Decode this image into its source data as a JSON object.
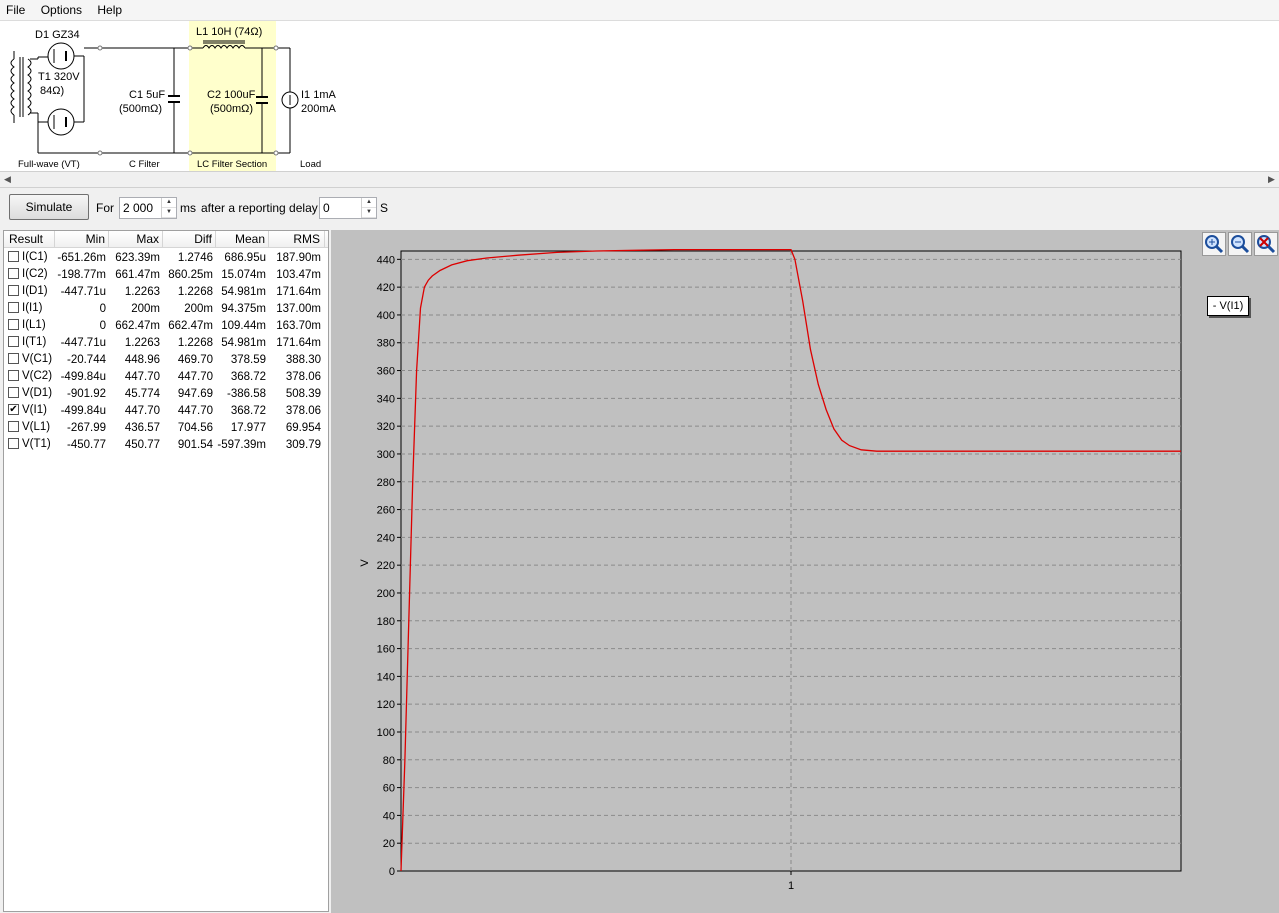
{
  "menu": [
    "File",
    "Options",
    "Help"
  ],
  "schematic": {
    "d1": "D1 GZ34",
    "t1": "T1 320V",
    "t1r": "84Ω)",
    "c1a": "C1 5uF",
    "c1b": "(500mΩ)",
    "l1": "L1 10H (74Ω)",
    "c2a": "C2 100uF",
    "c2b": "(500mΩ)",
    "i1a": "I1 1mA",
    "i1b": "200mA",
    "sec1": "Full-wave (VT)",
    "sec2": "C Filter",
    "sec3": "LC Filter Section",
    "sec4": "Load"
  },
  "toolbar": {
    "simulate": "Simulate",
    "for": "For",
    "duration": "2 000",
    "ms": "ms",
    "delay_label": "after a reporting delay of",
    "delay": "0",
    "s": "S"
  },
  "results": {
    "headers": [
      "Result",
      "Min",
      "Max",
      "Diff",
      "Mean",
      "RMS"
    ],
    "rows": [
      {
        "name": "I(C1)",
        "checked": false,
        "min": "-651.26m",
        "max": "623.39m",
        "diff": "1.2746",
        "mean": "686.95u",
        "rms": "187.90m"
      },
      {
        "name": "I(C2)",
        "checked": false,
        "min": "-198.77m",
        "max": "661.47m",
        "diff": "860.25m",
        "mean": "15.074m",
        "rms": "103.47m"
      },
      {
        "name": "I(D1)",
        "checked": false,
        "min": "-447.71u",
        "max": "1.2263",
        "diff": "1.2268",
        "mean": "54.981m",
        "rms": "171.64m"
      },
      {
        "name": "I(I1)",
        "checked": false,
        "min": "0",
        "max": "200m",
        "diff": "200m",
        "mean": "94.375m",
        "rms": "137.00m"
      },
      {
        "name": "I(L1)",
        "checked": false,
        "min": "0",
        "max": "662.47m",
        "diff": "662.47m",
        "mean": "109.44m",
        "rms": "163.70m"
      },
      {
        "name": "I(T1)",
        "checked": false,
        "min": "-447.71u",
        "max": "1.2263",
        "diff": "1.2268",
        "mean": "54.981m",
        "rms": "171.64m"
      },
      {
        "name": "V(C1)",
        "checked": false,
        "min": "-20.744",
        "max": "448.96",
        "diff": "469.70",
        "mean": "378.59",
        "rms": "388.30"
      },
      {
        "name": "V(C2)",
        "checked": false,
        "min": "-499.84u",
        "max": "447.70",
        "diff": "447.70",
        "mean": "368.72",
        "rms": "378.06"
      },
      {
        "name": "V(D1)",
        "checked": false,
        "min": "-901.92",
        "max": "45.774",
        "diff": "947.69",
        "mean": "-386.58",
        "rms": "508.39"
      },
      {
        "name": "V(I1)",
        "checked": true,
        "min": "-499.84u",
        "max": "447.70",
        "diff": "447.70",
        "mean": "368.72",
        "rms": "378.06"
      },
      {
        "name": "V(L1)",
        "checked": false,
        "min": "-267.99",
        "max": "436.57",
        "diff": "704.56",
        "mean": "17.977",
        "rms": "69.954"
      },
      {
        "name": "V(T1)",
        "checked": false,
        "min": "-450.77",
        "max": "450.77",
        "diff": "901.54",
        "mean": "-597.39m",
        "rms": "309.79"
      }
    ]
  },
  "zoom_icons": [
    "zoom-in-icon",
    "zoom-out-icon",
    "zoom-reset-icon"
  ],
  "legend": "- V(I1)",
  "chart_data": {
    "type": "line",
    "ylabel": "V",
    "xlabel": "",
    "ylim": [
      0,
      450
    ],
    "xlim": [
      0,
      2
    ],
    "yticks": [
      0,
      20,
      40,
      60,
      80,
      100,
      120,
      140,
      160,
      180,
      200,
      220,
      240,
      260,
      280,
      300,
      320,
      340,
      360,
      380,
      400,
      420,
      440
    ],
    "xticks": [
      1
    ],
    "grid": true,
    "series": [
      {
        "name": "V(I1)",
        "color": "#dd0000",
        "x": [
          0,
          0.01,
          0.02,
          0.03,
          0.04,
          0.05,
          0.06,
          0.07,
          0.08,
          0.1,
          0.13,
          0.17,
          0.22,
          0.3,
          0.4,
          0.5,
          0.6,
          0.7,
          0.8,
          0.9,
          0.98,
          1.0,
          1.01,
          1.03,
          1.05,
          1.07,
          1.09,
          1.11,
          1.13,
          1.15,
          1.18,
          1.22,
          1.3,
          1.5,
          1.7,
          2.0
        ],
        "y": [
          0,
          80,
          180,
          280,
          360,
          405,
          420,
          425,
          428,
          432,
          436,
          439,
          441,
          443,
          445,
          446,
          446.5,
          447,
          447,
          447,
          447,
          447,
          440,
          410,
          375,
          350,
          332,
          318,
          310,
          306,
          303,
          302,
          302,
          302,
          302,
          302
        ]
      }
    ]
  }
}
